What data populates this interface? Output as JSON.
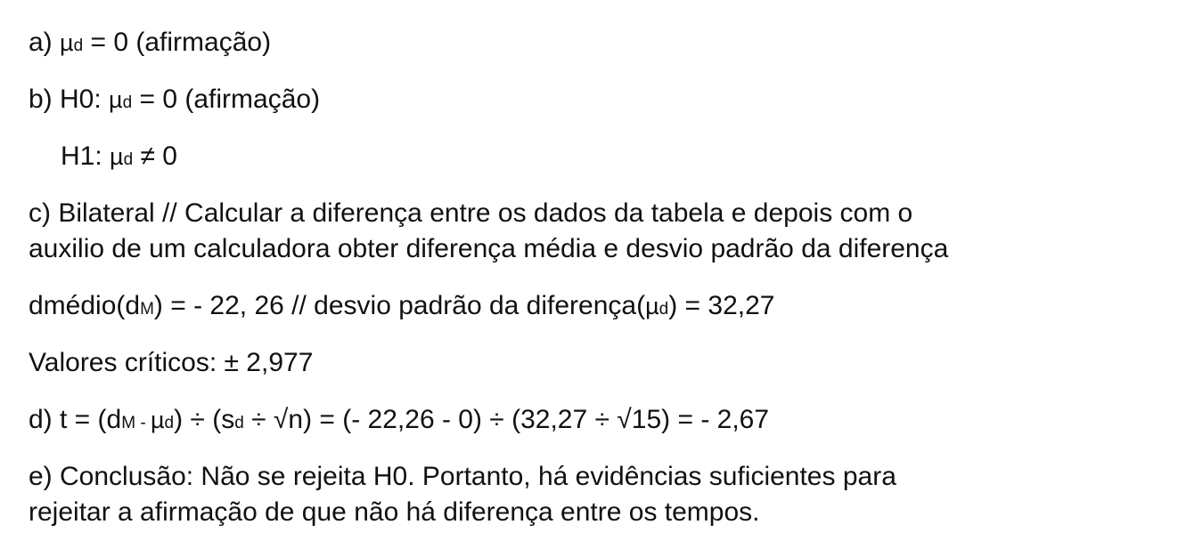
{
  "a": {
    "prefix": "a) ",
    "mu": "µ",
    "sub": "d",
    "rest": " = 0 (afirmação)"
  },
  "b": {
    "prefix": "b) H0: ",
    "mu": "µ",
    "sub": "d",
    "rest": " = 0 (afirmação)"
  },
  "h1": {
    "prefix": "H1: ",
    "mu": "µ",
    "sub": "d",
    "rest": " ≠ 0"
  },
  "c": {
    "line1": "c) Bilateral // Calcular a diferença entre os dados da tabela e depois com o",
    "line2": "auxilio de um calculadora obter diferença média e desvio padrão da diferença"
  },
  "dmedio": {
    "t1": "dmédio(d",
    "sub1": "M",
    "t2": ") = - 22, 26 // desvio padrão da diferença(",
    "mu": "µ",
    "sub2": "d",
    "t3": ") = 32,27"
  },
  "criticos": "Valores críticos: ± 2,977",
  "d": {
    "t1": "d) t = (d",
    "sub1": "M",
    "t2": " - ",
    "mu": "µ",
    "sub2": "d",
    "t3": ") ÷ (s",
    "sub3": "d",
    "t4": " ÷ √n) = (- 22,26 - 0) ÷ (32,27 ÷ √15) = - 2,67"
  },
  "e": {
    "line1": "e) Conclusão: Não se rejeita H0. Portanto, há evidências suficientes para",
    "line2": "rejeitar a afirmação de que não há diferença entre os tempos."
  }
}
